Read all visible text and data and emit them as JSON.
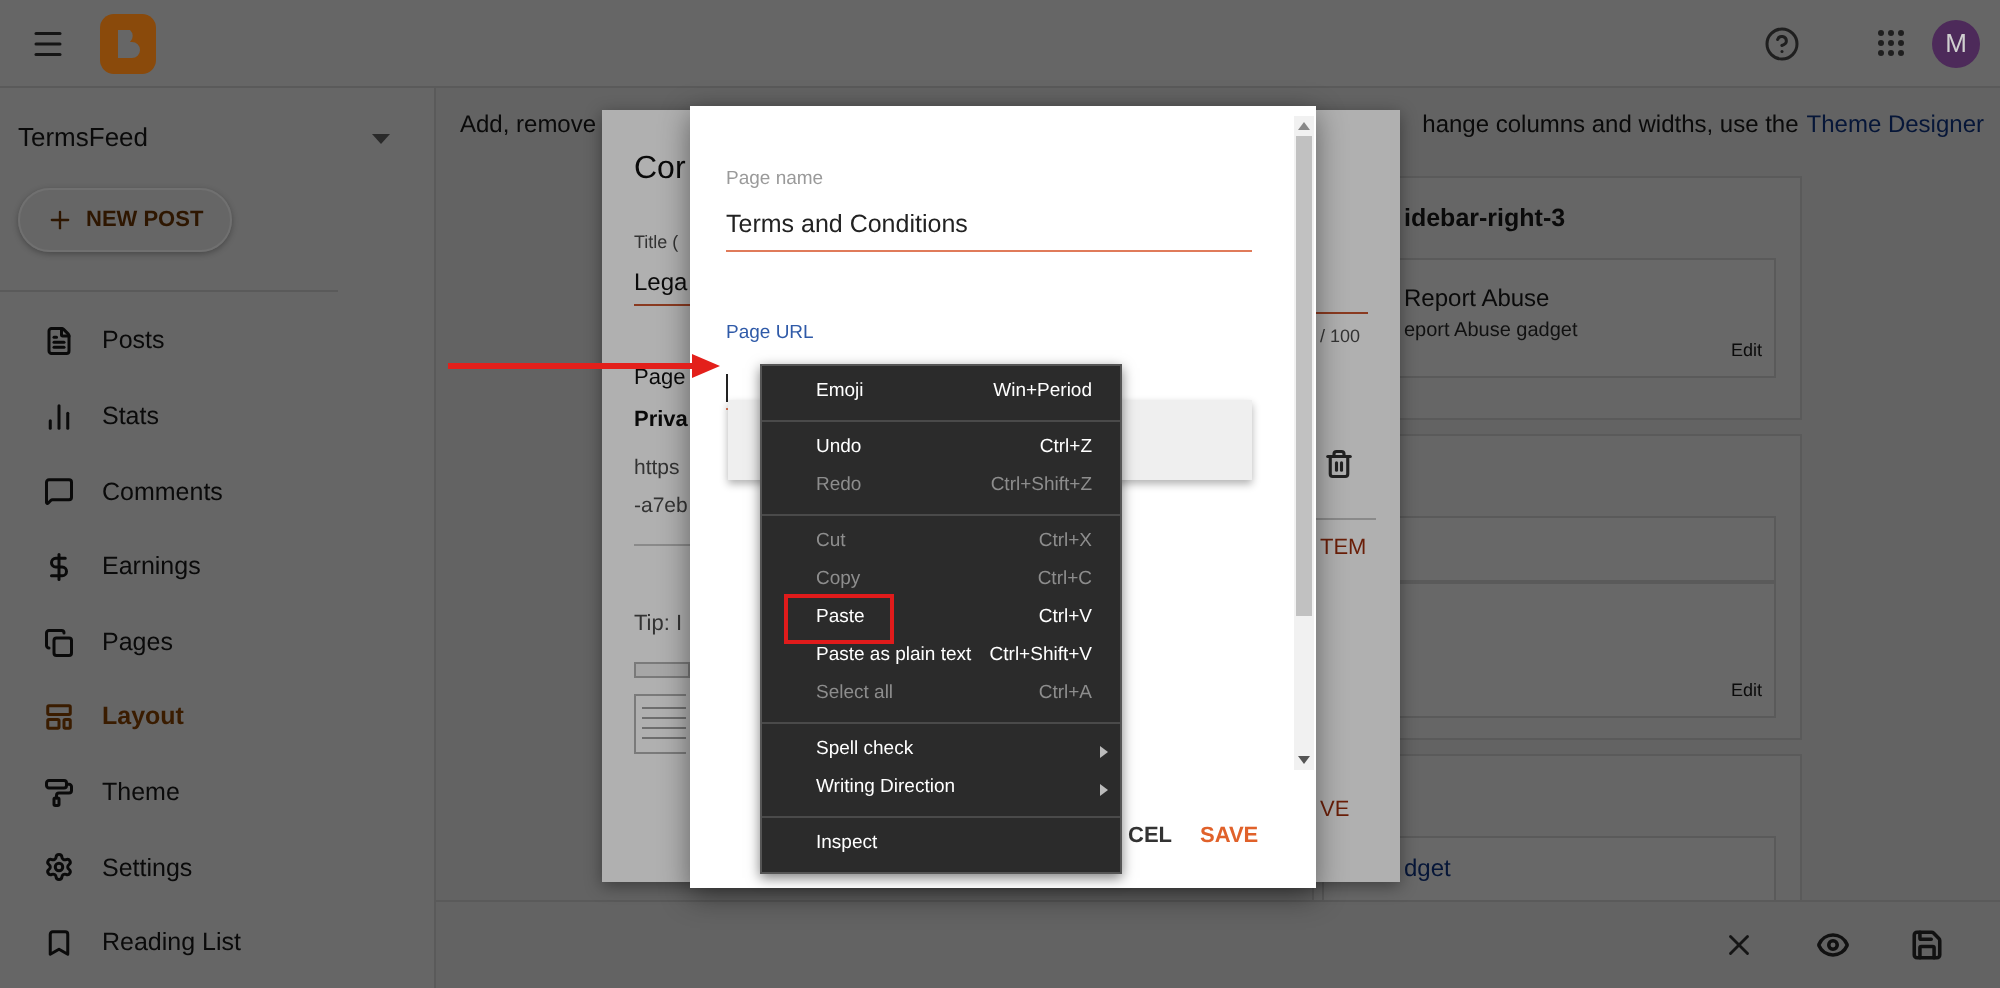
{
  "top_bar": {
    "avatar": "M"
  },
  "sidebar": {
    "blog_name": "TermsFeed",
    "new_post": "NEW POST",
    "items": [
      {
        "label": "Posts",
        "selected": false
      },
      {
        "label": "Stats",
        "selected": false
      },
      {
        "label": "Comments",
        "selected": false
      },
      {
        "label": "Earnings",
        "selected": false
      },
      {
        "label": "Pages",
        "selected": false
      },
      {
        "label": "Layout",
        "selected": true
      },
      {
        "label": "Theme",
        "selected": false
      },
      {
        "label": "Settings",
        "selected": false
      },
      {
        "label": "Reading List",
        "selected": false
      }
    ]
  },
  "main": {
    "intro_start": "Add, remove",
    "intro_end": "hange columns and widths, use the",
    "intro_link": "Theme Designer",
    "sections": [
      {
        "title": "idebar-right-3",
        "gadgets": [
          {
            "kind": "gadget",
            "name": "Report Abuse",
            "description": "eport Abuse gadget",
            "edit": "Edit"
          }
        ]
      },
      {
        "gadgets": [
          {
            "kind": "empty"
          },
          {
            "kind": "gadget",
            "edit": "Edit"
          }
        ]
      },
      {
        "gadgets": [
          {
            "kind": "link",
            "link": "dget"
          }
        ]
      }
    ]
  },
  "background_dialog": {
    "title": "Cor",
    "title_label": "Title (",
    "title_value": "Lega",
    "page_label": "Page",
    "page_value": "Priva",
    "url_lines": [
      "https",
      "-a7eb"
    ],
    "tip": "Tip: I",
    "counter": "/ 100",
    "add_item": "TEM",
    "save": "VE"
  },
  "dialog": {
    "page_name_label": "Page name",
    "page_name_value": "Terms and Conditions",
    "page_url_label": "Page URL",
    "cancel": "CEL",
    "save": "SAVE"
  },
  "context_menu": {
    "groups": [
      [
        {
          "label": "Emoji",
          "shortcut": "Win+Period",
          "disabled": false,
          "submenu": false,
          "highlighted": false
        }
      ],
      [
        {
          "label": "Undo",
          "shortcut": "Ctrl+Z",
          "disabled": false,
          "submenu": false,
          "highlighted": false
        },
        {
          "label": "Redo",
          "shortcut": "Ctrl+Shift+Z",
          "disabled": true,
          "submenu": false,
          "highlighted": false
        }
      ],
      [
        {
          "label": "Cut",
          "shortcut": "Ctrl+X",
          "disabled": true,
          "submenu": false,
          "highlighted": false
        },
        {
          "label": "Copy",
          "shortcut": "Ctrl+C",
          "disabled": true,
          "submenu": false,
          "highlighted": false
        },
        {
          "label": "Paste",
          "shortcut": "Ctrl+V",
          "disabled": false,
          "submenu": false,
          "highlighted": true
        },
        {
          "label": "Paste as plain text",
          "shortcut": "Ctrl+Shift+V",
          "disabled": false,
          "submenu": false,
          "highlighted": false
        },
        {
          "label": "Select all",
          "shortcut": "Ctrl+A",
          "disabled": true,
          "submenu": false,
          "highlighted": false
        }
      ],
      [
        {
          "label": "Spell check",
          "disabled": false,
          "submenu": true,
          "highlighted": false
        },
        {
          "label": "Writing Direction",
          "disabled": false,
          "submenu": true,
          "highlighted": false
        }
      ],
      [
        {
          "label": "Inspect",
          "disabled": false,
          "submenu": false,
          "highlighted": false
        }
      ]
    ]
  }
}
